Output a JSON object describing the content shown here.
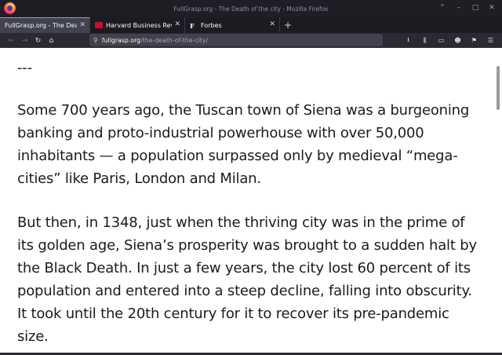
{
  "window": {
    "title": "FullGrasp.org - The Death of the city - Mozilla Firefox"
  },
  "tabs": [
    {
      "label": "FullGrasp.org - The Death of",
      "active": true,
      "favicon": "none"
    },
    {
      "label": "Harvard Business Review",
      "active": false,
      "favicon": "hbr-icon"
    },
    {
      "label": "Forbes",
      "active": false,
      "favicon": "forbes-icon"
    }
  ],
  "urlbar": {
    "host": "fullgrasp.org",
    "path": "/the-death-of-the-city/"
  },
  "article": {
    "separator": "---",
    "paragraphs": [
      "Some 700 years ago, the Tuscan town of Siena was a burgeoning banking and proto-industrial powerhouse with over 50,000 inhabitants — a population surpassed only by medieval “mega-cities” like Paris, London and Milan.",
      "But then, in 1348, just when the thriving city was in the prime of its golden age, Siena’s prosperity was brought to a sudden halt by the Black Death. In just a few years, the city lost 60 percent of its population and entered into a steep decline, falling into obscurity. It took until the 20th century for it to recover its pre-pandemic size."
    ]
  },
  "icons": {
    "back": "back-arrow-icon",
    "forward": "forward-arrow-icon",
    "reload": "reload-icon",
    "home": "home-icon",
    "downloads": "download-icon",
    "library": "library-icon",
    "sidebar": "sidebar-icon",
    "account": "account-icon",
    "extensions": "gift-icon",
    "menu": "hamburger-menu-icon"
  },
  "colors": {
    "accent": "#00ddff",
    "chrome_dark": "#1c1b22",
    "toolbar": "#2b2a33",
    "urlbar": "#42414d"
  }
}
